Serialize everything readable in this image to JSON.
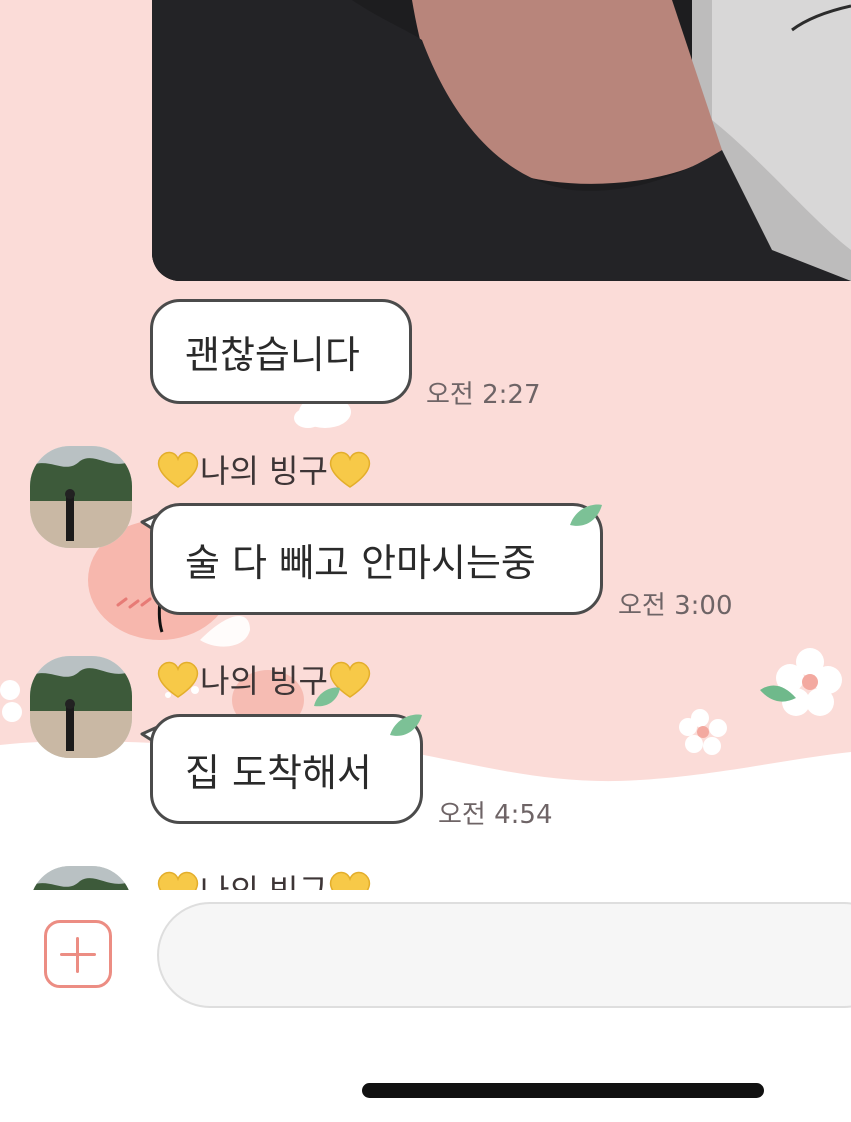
{
  "chat": {
    "messages": [
      {
        "kind": "photo",
        "content": "photo-of-person-in-black-shirt"
      },
      {
        "kind": "text",
        "text": "괜찮습니다",
        "time": "오전 2:27"
      },
      {
        "kind": "text",
        "sender": "나의 빙구",
        "text": "술 다 빼고 안마시는중",
        "time": "오전 3:00"
      },
      {
        "kind": "text",
        "sender": "나의 빙구",
        "text": "집 도착해서",
        "time": "오전 4:54"
      },
      {
        "kind": "partial",
        "sender": "나의 빙구"
      }
    ]
  },
  "input_bar": {
    "plus_icon": "plus-square-icon",
    "message_value": "",
    "message_placeholder": ""
  },
  "colors": {
    "chat_background": "#fbdcd8",
    "bubble_border": "#4b4b4b",
    "accent": "#ec8d83",
    "leaf": "#7cc196",
    "heart": "#f7c948"
  }
}
